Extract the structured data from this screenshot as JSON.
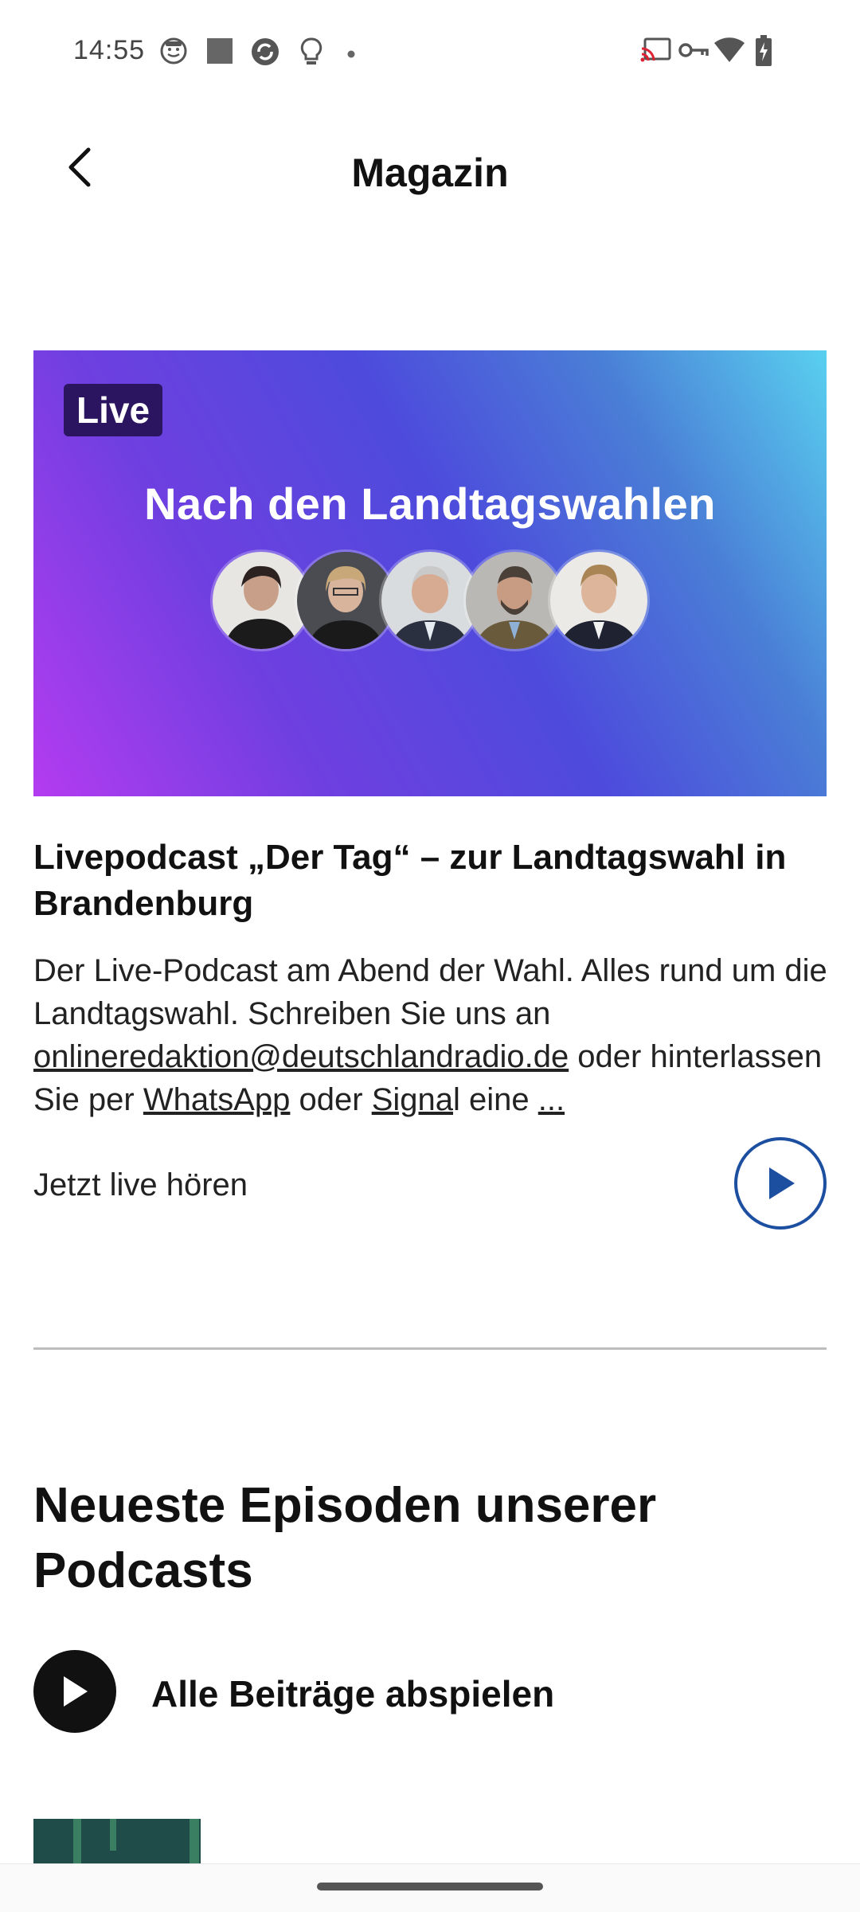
{
  "status_bar": {
    "time": "14:55"
  },
  "header": {
    "title": "Magazin",
    "back_label": "Zurück"
  },
  "hero": {
    "badge": "Live",
    "title": "Nach den Landtagswahlen"
  },
  "episode": {
    "title": "Livepodcast „Der Tag“ – zur Landtagswahl in Brandenburg",
    "desc_part1": "Der Live-Podcast am Abend der Wahl. Alles rund um die Landtagswahl. Schreiben Sie uns an ",
    "email": "onlineredaktion@deutschlandradio.de",
    "desc_part2": " oder hinterlassen Sie per ",
    "whatsapp": "WhatsApp",
    "desc_part3": " oder ",
    "signal_underlined": "Signa",
    "desc_part4": "l eine ",
    "more": "...",
    "listen_label": "Jetzt live hören"
  },
  "section": {
    "title": "Neueste Episoden unserer Podcasts",
    "play_all_label": "Alle Beiträge abspielen"
  },
  "colors": {
    "accent_blue": "#1d4fa1",
    "hero_gradient_start": "#b43cf0",
    "hero_gradient_end": "#59d0ef",
    "badge_bg": "#2b1460"
  }
}
